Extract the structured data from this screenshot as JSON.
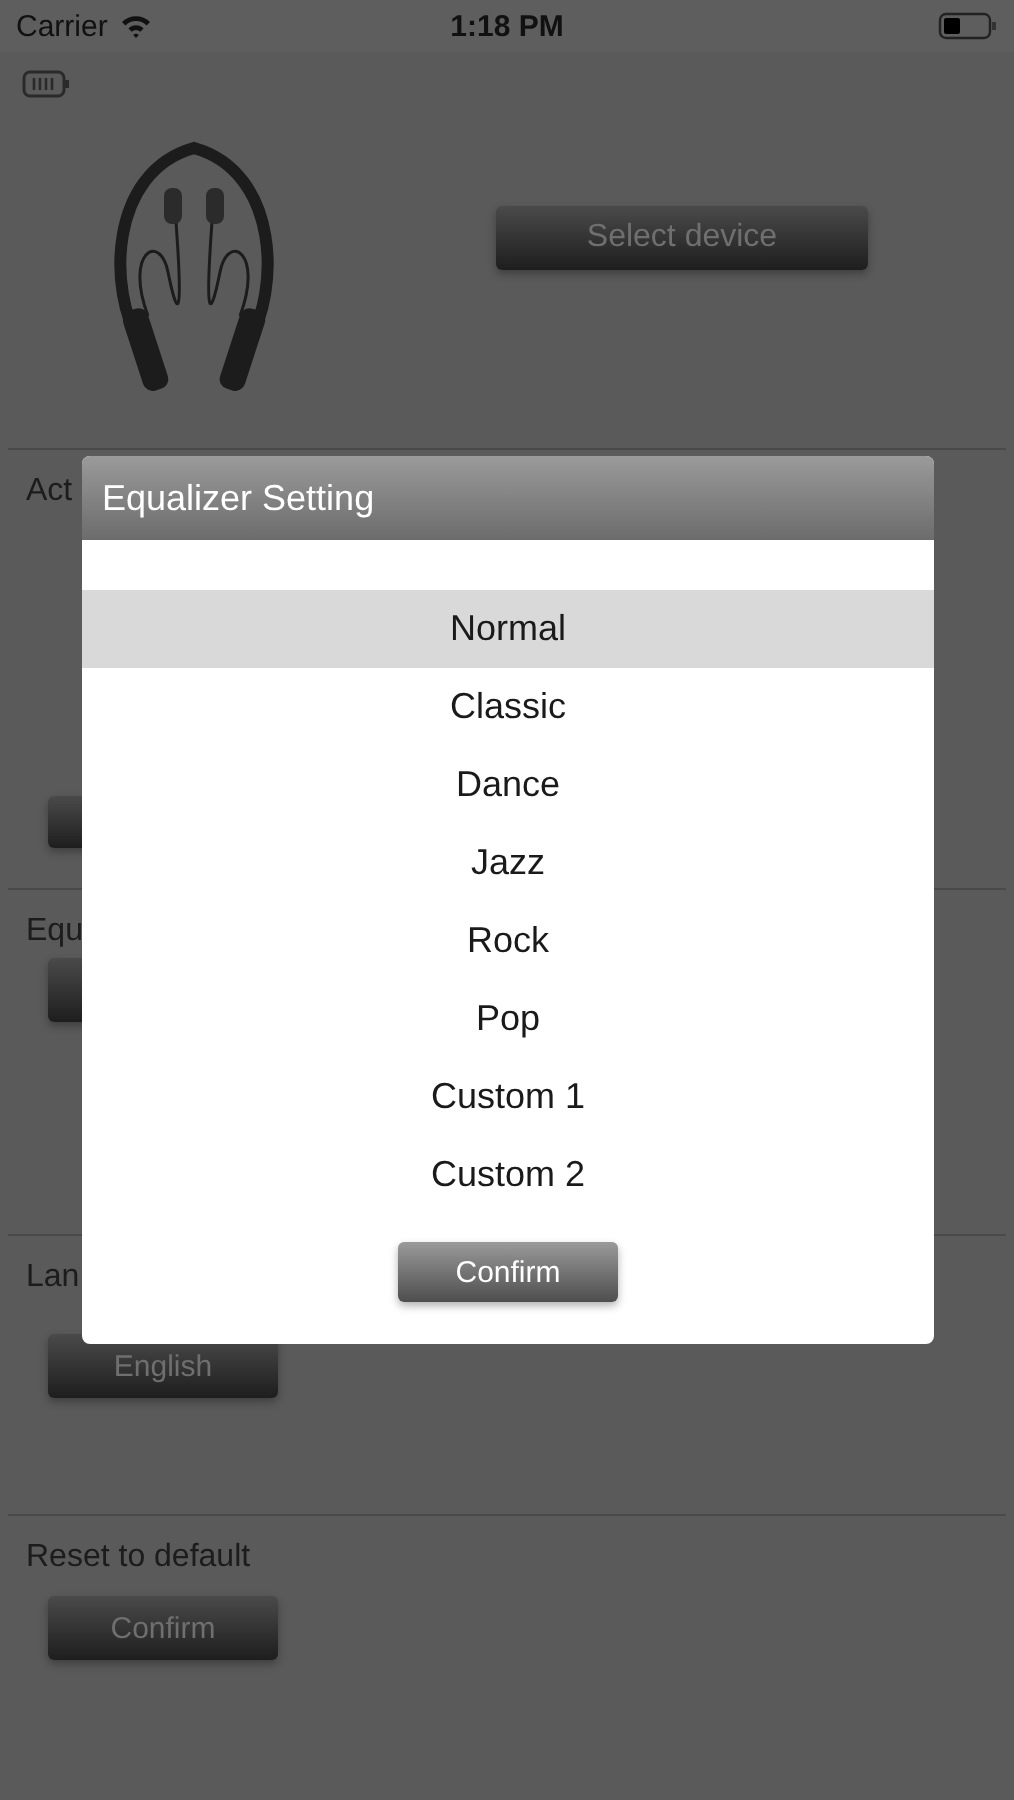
{
  "status_bar": {
    "carrier": "Carrier",
    "time": "1:18 PM"
  },
  "device": {
    "button": "Select device"
  },
  "sections": [
    {
      "label": "Act"
    },
    {
      "label": "Equ"
    },
    {
      "label": "Lan",
      "button": "English"
    },
    {
      "label": "Reset to default",
      "button": "Confirm"
    }
  ],
  "dialog": {
    "title": "Equalizer Setting",
    "options": [
      {
        "label": "Normal",
        "selected": true
      },
      {
        "label": "Classic",
        "selected": false
      },
      {
        "label": "Dance",
        "selected": false
      },
      {
        "label": "Jazz",
        "selected": false
      },
      {
        "label": "Rock",
        "selected": false
      },
      {
        "label": "Pop",
        "selected": false
      },
      {
        "label": "Custom 1",
        "selected": false
      },
      {
        "label": "Custom 2",
        "selected": false
      }
    ],
    "confirm": "Confirm"
  }
}
